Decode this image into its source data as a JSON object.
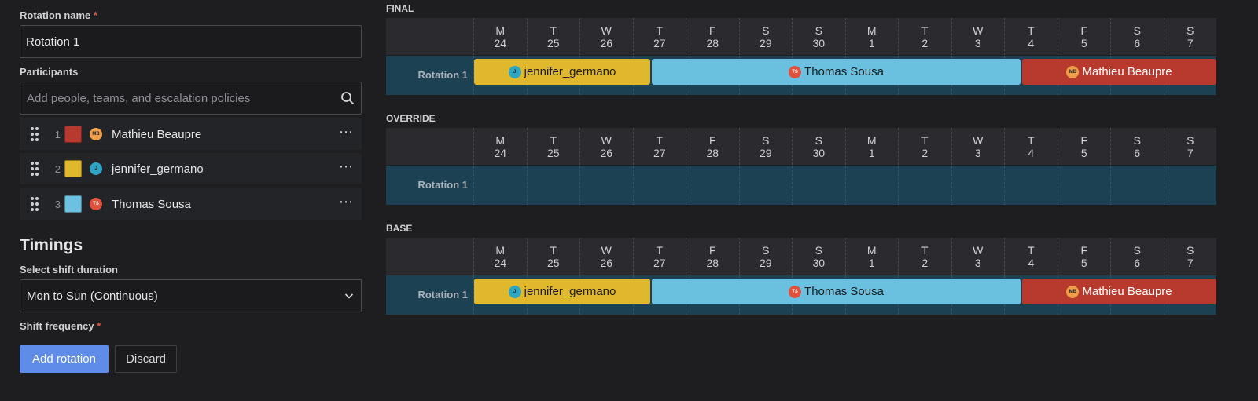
{
  "form": {
    "rotation_name_label": "Rotation name",
    "required_mark": "*",
    "rotation_name_value": "Rotation 1",
    "participants_label": "Participants",
    "participants_placeholder": "Add people, teams, and escalation policies",
    "participants": [
      {
        "index": "1",
        "name": "Mathieu Beaupre",
        "initials": "MB",
        "color": "#b83a2e",
        "avatar_color": "#f0a04b"
      },
      {
        "index": "2",
        "name": "jennifer_germano",
        "initials": "J",
        "color": "#e0b82c",
        "avatar_color": "#2fa5c4"
      },
      {
        "index": "3",
        "name": "Thomas Sousa",
        "initials": "TS",
        "color": "#6cc0e0",
        "avatar_color": "#e0503a"
      }
    ],
    "more_icon": "⋯",
    "timings_heading": "Timings",
    "shift_duration_label": "Select shift duration",
    "shift_duration_value": "Mon to Sun (Continuous)",
    "shift_frequency_label": "Shift frequency",
    "add_button": "Add rotation",
    "discard_button": "Discard"
  },
  "days": [
    {
      "w": "M",
      "d": "24"
    },
    {
      "w": "T",
      "d": "25"
    },
    {
      "w": "W",
      "d": "26"
    },
    {
      "w": "T",
      "d": "27"
    },
    {
      "w": "F",
      "d": "28"
    },
    {
      "w": "S",
      "d": "29"
    },
    {
      "w": "S",
      "d": "30"
    },
    {
      "w": "M",
      "d": "1"
    },
    {
      "w": "T",
      "d": "2"
    },
    {
      "w": "W",
      "d": "3"
    },
    {
      "w": "T",
      "d": "4"
    },
    {
      "w": "F",
      "d": "5"
    },
    {
      "w": "S",
      "d": "6"
    },
    {
      "w": "S",
      "d": "7"
    }
  ],
  "timelines": {
    "final": {
      "title": "FINAL",
      "row_label": "Rotation 1"
    },
    "override": {
      "title": "OVERRIDE",
      "row_label": "Rotation 1"
    },
    "base": {
      "title": "BASE",
      "row_label": "Rotation 1"
    }
  },
  "shifts": {
    "jennifer": {
      "name": "jennifer_germano",
      "initials": "J"
    },
    "thomas": {
      "name": "Thomas Sousa",
      "initials": "TS"
    },
    "mathieu": {
      "name": "Mathieu Beaupre",
      "initials": "MB"
    }
  },
  "colors": {
    "mathieu": "#b83a2e",
    "jennifer": "#dfb82d",
    "thomas": "#6ac0df",
    "primary_button": "#5e8ce8",
    "timeline_body": "#1c4152"
  }
}
